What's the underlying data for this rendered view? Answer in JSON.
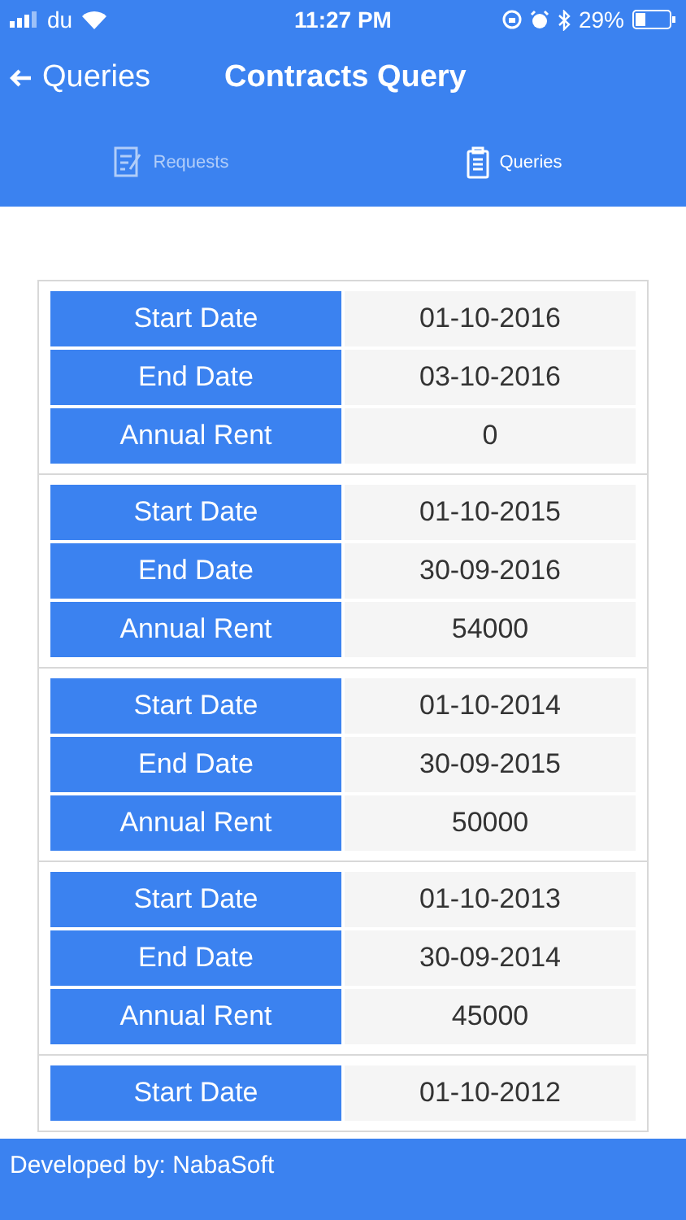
{
  "status_bar": {
    "carrier": "du",
    "time": "11:27 PM",
    "battery": "29%"
  },
  "nav": {
    "back_label": "Queries",
    "title": "Contracts Query"
  },
  "tabs": [
    {
      "label": "Requests",
      "kind": "form",
      "selected": false
    },
    {
      "label": "Queries",
      "kind": "clipboard",
      "selected": true
    }
  ],
  "contracts": [
    {
      "fields": [
        {
          "label": "Start Date",
          "value": "01-10-2016"
        },
        {
          "label": "End Date",
          "value": "03-10-2016"
        },
        {
          "label": "Annual Rent",
          "value": "0"
        }
      ]
    },
    {
      "fields": [
        {
          "label": "Start Date",
          "value": "01-10-2015"
        },
        {
          "label": "End Date",
          "value": "30-09-2016"
        },
        {
          "label": "Annual Rent",
          "value": "54000"
        }
      ]
    },
    {
      "fields": [
        {
          "label": "Start Date",
          "value": "01-10-2014"
        },
        {
          "label": "End Date",
          "value": "30-09-2015"
        },
        {
          "label": "Annual Rent",
          "value": "50000"
        }
      ]
    },
    {
      "fields": [
        {
          "label": "Start Date",
          "value": "01-10-2013"
        },
        {
          "label": "End Date",
          "value": "30-09-2014"
        },
        {
          "label": "Annual Rent",
          "value": "45000"
        }
      ]
    },
    {
      "fields": [
        {
          "label": "Start Date",
          "value": "01-10-2012"
        }
      ]
    }
  ],
  "footer": "Developed by: NabaSoft"
}
